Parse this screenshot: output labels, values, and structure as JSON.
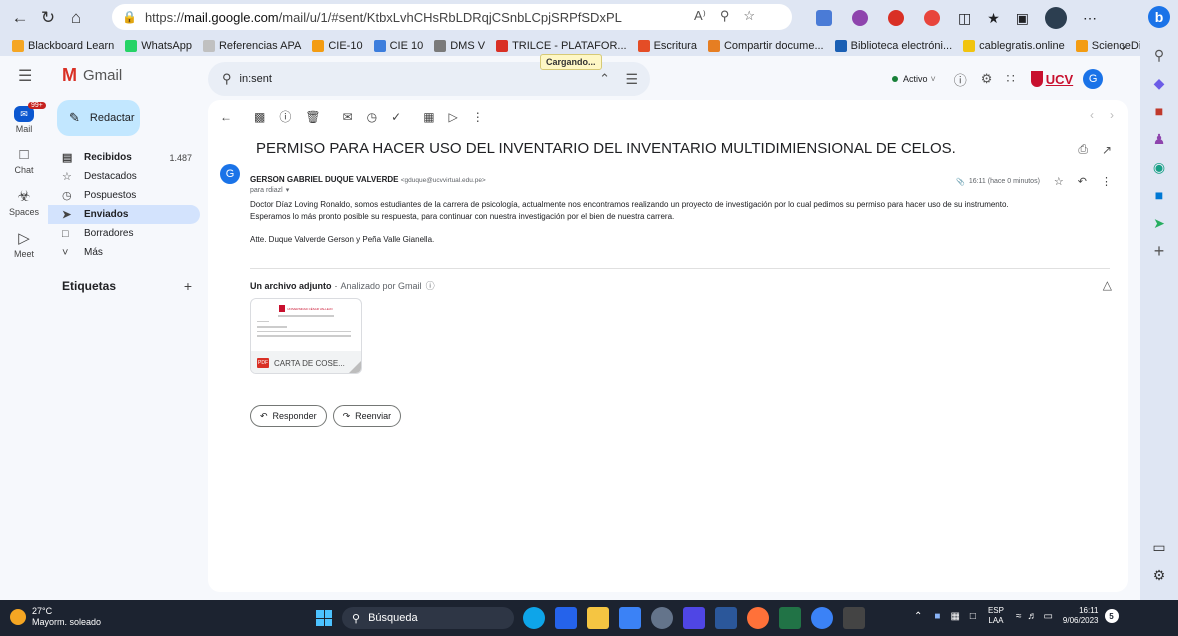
{
  "browser": {
    "url_prefix": "https://",
    "url_domain": "mail.google.com",
    "url_path": "/mail/u/1/#sent/KtbxLvhCHsRbLDRqjCSnbLCpjSRPfSDxPL",
    "loading_tooltip": "Cargando...",
    "bookmarks": [
      {
        "label": "Blackboard Learn",
        "color": "#f5a623"
      },
      {
        "label": "WhatsApp",
        "color": "#25d366"
      },
      {
        "label": "Referencias APA",
        "color": "#c0c0c0"
      },
      {
        "label": "CIE-10",
        "color": "#f39c12"
      },
      {
        "label": "CIE 10",
        "color": "#3b7ddd"
      },
      {
        "label": "DMS V",
        "color": "#7a7a7a"
      },
      {
        "label": "TRILCE - PLATAFOR...",
        "color": "#d93025"
      },
      {
        "label": "Escritura",
        "color": "#e44d26"
      },
      {
        "label": "Compartir docume...",
        "color": "#e67e22"
      },
      {
        "label": "Biblioteca electróni...",
        "color": "#1a5fb4"
      },
      {
        "label": "cablegratis.online",
        "color": "#f1c40f"
      },
      {
        "label": "ScienceDirect.com |...",
        "color": "#f39c12"
      }
    ]
  },
  "gmail": {
    "logo_text": "Gmail",
    "search_value": "in:sent",
    "status": "Activo",
    "brand_badge": "UCV",
    "avatar_letter": "G",
    "rail": [
      {
        "label": "Mail",
        "badge": "99+"
      },
      {
        "label": "Chat"
      },
      {
        "label": "Spaces"
      },
      {
        "label": "Meet"
      }
    ],
    "compose_label": "Redactar",
    "nav": [
      {
        "label": "Recibidos",
        "count": "1.487"
      },
      {
        "label": "Destacados",
        "count": ""
      },
      {
        "label": "Pospuestos",
        "count": ""
      },
      {
        "label": "Enviados",
        "count": ""
      },
      {
        "label": "Borradores",
        "count": ""
      },
      {
        "label": "Más",
        "count": ""
      }
    ],
    "labels_heading": "Etiquetas",
    "labels_add": "+"
  },
  "email": {
    "subject": "PERMISO PARA HACER USO DEL INVENTARIO DEL INVENTARIO MULTIDIMIENSIONAL DE CELOS.",
    "sender_name": "GERSON GABRIEL DUQUE VALVERDE",
    "sender_email": "<gduque@ucvvirtual.edu.pe>",
    "to": "para rdiazl",
    "time": "16:11 (hace 0 minutos)",
    "body_line1": "Doctor Díaz Loving Ronaldo, somos estudiantes de la carrera de psicología, actualmente nos encontramos realizando un proyecto de investigación por lo cual pedimos su permiso para hacer uso de su instrumento.",
    "body_line2": "Esperamos lo más pronto posible su respuesta, para continuar con nuestra investigación por el bien de nuestra carrera.",
    "body_line3": "Atte. Duque Valverde Gerson y Peña Valle Gianella.",
    "attach_heading": "Un archivo adjunto",
    "attach_scanned": "Analizado por Gmail",
    "attach_name": "CARTA DE COSE...",
    "attach_thumb_title": "UNIVERSIDAD CÉSAR VALLEJO",
    "reply_label": "Responder",
    "forward_label": "Reenviar"
  },
  "taskbar": {
    "weather_temp": "27°C",
    "weather_desc": "Mayorm. soleado",
    "search_label": "Búsqueda",
    "lang_top": "ESP",
    "lang_bottom": "LAA",
    "time": "16:11",
    "date": "9/06/2023",
    "notif_count": "5"
  },
  "colors": {
    "accent": "#1a73e8",
    "compose": "#c2e7ff",
    "active_nav": "#d3e3fd",
    "ucv_red": "#c8102e",
    "status_green": "#188038"
  }
}
